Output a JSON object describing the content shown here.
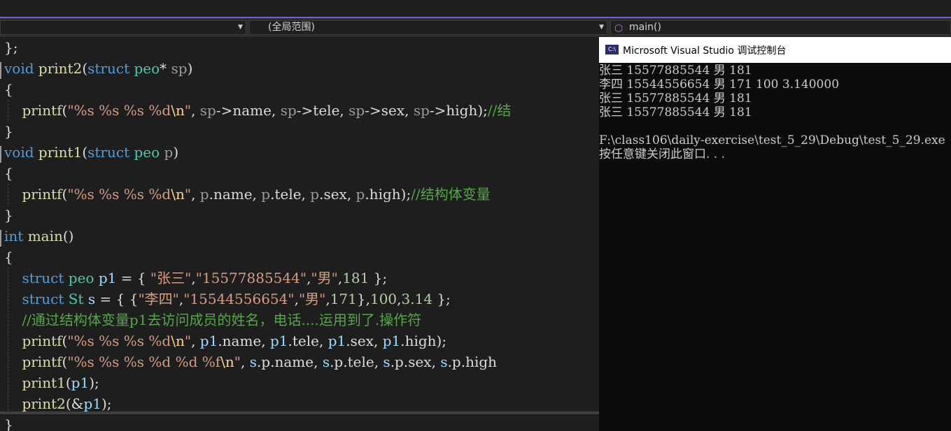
{
  "navbar": {
    "project_combo": "",
    "scope_combo": "(全局范围)",
    "function_combo": "main()"
  },
  "editor": {
    "lines": [
      [
        [
          "op",
          "};"
        ]
      ],
      [
        [
          "kw",
          "void"
        ],
        [
          "op",
          " "
        ],
        [
          "fn",
          "print2"
        ],
        [
          "op",
          "("
        ],
        [
          "kw",
          "struct"
        ],
        [
          "op",
          " "
        ],
        [
          "ty",
          "peo"
        ],
        [
          "op",
          "* "
        ],
        [
          "pa",
          "sp"
        ],
        [
          "op",
          ")"
        ]
      ],
      [
        [
          "op",
          "{"
        ]
      ],
      [
        [
          "op",
          "    "
        ],
        [
          "fn",
          "printf"
        ],
        [
          "op",
          "("
        ],
        [
          "str",
          "\"%s %s %s %d"
        ],
        [
          "esc",
          "\\n"
        ],
        [
          "str",
          "\""
        ],
        [
          "op",
          ", "
        ],
        [
          "pa",
          "sp"
        ],
        [
          "op",
          "->name, "
        ],
        [
          "pa",
          "sp"
        ],
        [
          "op",
          "->tele, "
        ],
        [
          "pa",
          "sp"
        ],
        [
          "op",
          "->sex, "
        ],
        [
          "pa",
          "sp"
        ],
        [
          "op",
          "->high);"
        ],
        [
          "cm",
          "//结"
        ]
      ],
      [
        [
          "op",
          "}"
        ]
      ],
      [
        [
          "kw",
          "void"
        ],
        [
          "op",
          " "
        ],
        [
          "fn",
          "print1"
        ],
        [
          "op",
          "("
        ],
        [
          "kw",
          "struct"
        ],
        [
          "op",
          " "
        ],
        [
          "ty",
          "peo"
        ],
        [
          "op",
          " "
        ],
        [
          "pa",
          "p"
        ],
        [
          "op",
          ")"
        ]
      ],
      [
        [
          "op",
          "{"
        ]
      ],
      [
        [
          "op",
          "    "
        ],
        [
          "fn",
          "printf"
        ],
        [
          "op",
          "("
        ],
        [
          "str",
          "\"%s %s %s %d"
        ],
        [
          "esc",
          "\\n"
        ],
        [
          "str",
          "\""
        ],
        [
          "op",
          ", "
        ],
        [
          "pa",
          "p"
        ],
        [
          "op",
          ".name, "
        ],
        [
          "pa",
          "p"
        ],
        [
          "op",
          ".tele, "
        ],
        [
          "pa",
          "p"
        ],
        [
          "op",
          ".sex, "
        ],
        [
          "pa",
          "p"
        ],
        [
          "op",
          ".high);"
        ],
        [
          "cm",
          "//结构体变量"
        ]
      ],
      [
        [
          "op",
          "}"
        ]
      ],
      [
        [
          "kw",
          "int"
        ],
        [
          "op",
          " "
        ],
        [
          "fn",
          "main"
        ],
        [
          "op",
          "()"
        ]
      ],
      [
        [
          "op",
          "{"
        ]
      ],
      [
        [
          "op",
          "    "
        ],
        [
          "kw",
          "struct"
        ],
        [
          "op",
          " "
        ],
        [
          "ty",
          "peo"
        ],
        [
          "op",
          " "
        ],
        [
          "var",
          "p1"
        ],
        [
          "op",
          " = { "
        ],
        [
          "str",
          "\"张三\""
        ],
        [
          "op",
          ","
        ],
        [
          "str",
          "\"15577885544\""
        ],
        [
          "op",
          ","
        ],
        [
          "str",
          "\"男\""
        ],
        [
          "op",
          ","
        ],
        [
          "num",
          "181"
        ],
        [
          "op",
          " };"
        ]
      ],
      [
        [
          "op",
          "    "
        ],
        [
          "kw",
          "struct"
        ],
        [
          "op",
          " "
        ],
        [
          "ty",
          "St"
        ],
        [
          "op",
          " "
        ],
        [
          "var",
          "s"
        ],
        [
          "op",
          " = { {"
        ],
        [
          "str",
          "\"李四\""
        ],
        [
          "op",
          ","
        ],
        [
          "str",
          "\"15544556654\""
        ],
        [
          "op",
          ","
        ],
        [
          "str",
          "\"男\""
        ],
        [
          "op",
          ","
        ],
        [
          "num",
          "171"
        ],
        [
          "op",
          "},"
        ],
        [
          "num",
          "100"
        ],
        [
          "op",
          ","
        ],
        [
          "num",
          "3.14"
        ],
        [
          "op",
          " };"
        ]
      ],
      [
        [
          "op",
          "    "
        ],
        [
          "cm",
          "//通过结构体变量p1去访问成员的姓名，电话....运用到了.操作符"
        ]
      ],
      [
        [
          "op",
          "    "
        ],
        [
          "fn",
          "printf"
        ],
        [
          "op",
          "("
        ],
        [
          "str",
          "\"%s %s %s %d"
        ],
        [
          "esc",
          "\\n"
        ],
        [
          "str",
          "\""
        ],
        [
          "op",
          ", "
        ],
        [
          "var",
          "p1"
        ],
        [
          "op",
          ".name, "
        ],
        [
          "var",
          "p1"
        ],
        [
          "op",
          ".tele, "
        ],
        [
          "var",
          "p1"
        ],
        [
          "op",
          ".sex, "
        ],
        [
          "var",
          "p1"
        ],
        [
          "op",
          ".high);"
        ]
      ],
      [
        [
          "op",
          "    "
        ],
        [
          "fn",
          "printf"
        ],
        [
          "op",
          "("
        ],
        [
          "str",
          "\"%s %s %s %d %d %f"
        ],
        [
          "esc",
          "\\n"
        ],
        [
          "str",
          "\""
        ],
        [
          "op",
          ", "
        ],
        [
          "var",
          "s"
        ],
        [
          "op",
          ".p.name, "
        ],
        [
          "var",
          "s"
        ],
        [
          "op",
          ".p.tele, "
        ],
        [
          "var",
          "s"
        ],
        [
          "op",
          ".p.sex, "
        ],
        [
          "var",
          "s"
        ],
        [
          "op",
          ".p.high"
        ]
      ],
      [
        [
          "op",
          "    "
        ],
        [
          "fn",
          "print1"
        ],
        [
          "op",
          "("
        ],
        [
          "var",
          "p1"
        ],
        [
          "op",
          ");"
        ]
      ],
      [
        [
          "op",
          "    "
        ],
        [
          "fn",
          "print2"
        ],
        [
          "op",
          "(&"
        ],
        [
          "var",
          "p1"
        ],
        [
          "op",
          ");"
        ]
      ],
      [
        [
          "op",
          "}"
        ]
      ]
    ]
  },
  "console": {
    "icon_text": "C:\\",
    "title": "Microsoft Visual Studio 调试控制台",
    "lines": [
      "张三 15577885544 男 181",
      "李四 15544556654 男 171 100 3.140000",
      "张三 15577885544 男 181",
      "张三 15577885544 男 181",
      "",
      "F:\\class106\\daily-exercise\\test_5_29\\Debug\\test_5_29.exe",
      "按任意键关闭此窗口. . ."
    ]
  },
  "colors": {
    "accent": "#7c5cd6",
    "editor_bg": "#1e1e1e",
    "console_bg": "#0c0c0c",
    "keyword": "#569cd6",
    "type": "#4ec9b0",
    "function": "#dcdcaa",
    "string": "#d69d85",
    "comment": "#57a64a",
    "number": "#b5cea8"
  }
}
